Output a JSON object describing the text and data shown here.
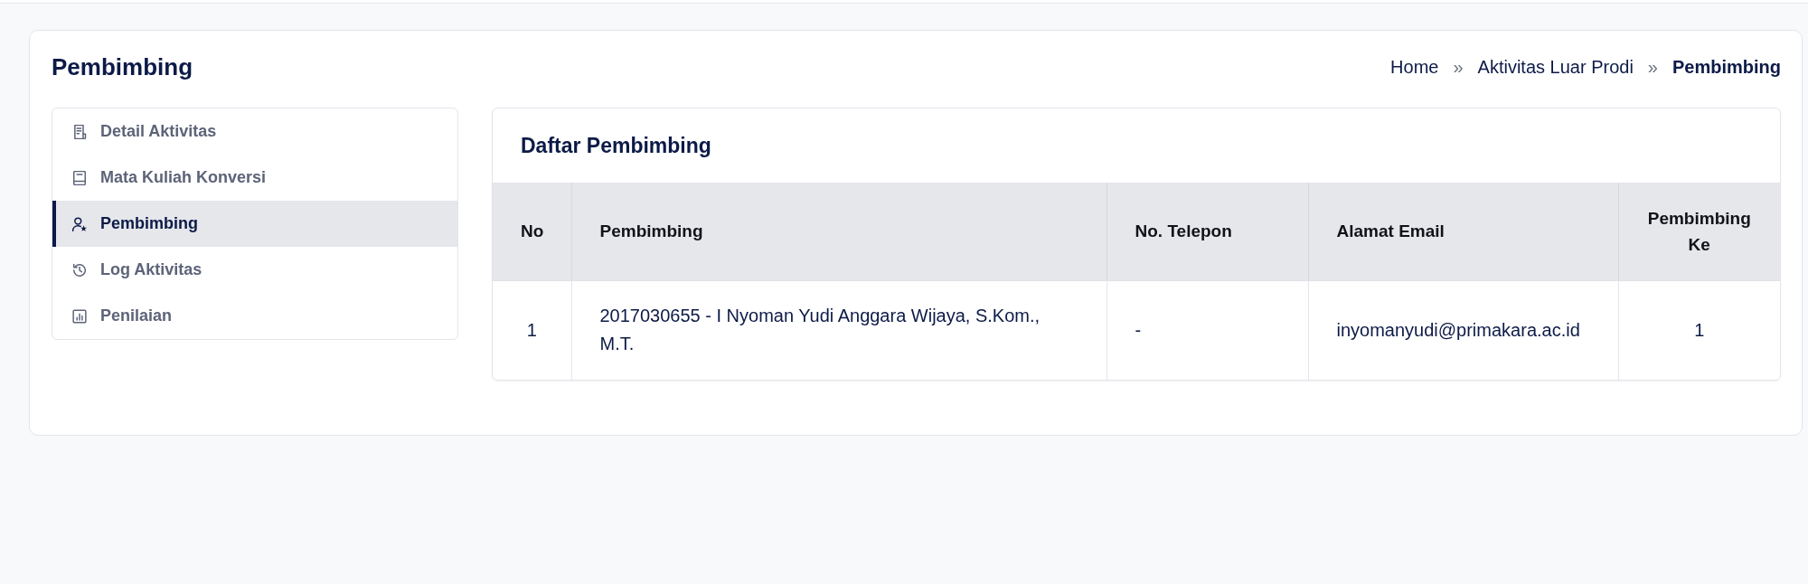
{
  "page": {
    "title": "Pembimbing"
  },
  "breadcrumb": {
    "items": [
      {
        "label": "Home",
        "current": false
      },
      {
        "label": "Aktivitas Luar Prodi",
        "current": false,
        "separator": "»"
      },
      {
        "label": "Pembimbing",
        "current": true,
        "separator": "»"
      }
    ]
  },
  "sidebar": {
    "items": [
      {
        "label": "Detail Aktivitas",
        "selected": false
      },
      {
        "label": "Mata Kuliah Konversi",
        "selected": false
      },
      {
        "label": "Pembimbing",
        "selected": true
      },
      {
        "label": "Log Aktivitas",
        "selected": false
      },
      {
        "label": "Penilaian",
        "selected": false
      }
    ]
  },
  "panel": {
    "title": "Daftar Pembimbing",
    "table": {
      "columns": [
        "No",
        "Pembimbing",
        "No. Telepon",
        "Alamat Email",
        "Pembimbing Ke"
      ],
      "rows": [
        [
          "1",
          "2017030655 - I Nyoman Yudi Anggara Wijaya, S.Kom., M.T.",
          "-",
          "inyomanyudi@primakara.ac.id",
          "1"
        ]
      ]
    }
  }
}
